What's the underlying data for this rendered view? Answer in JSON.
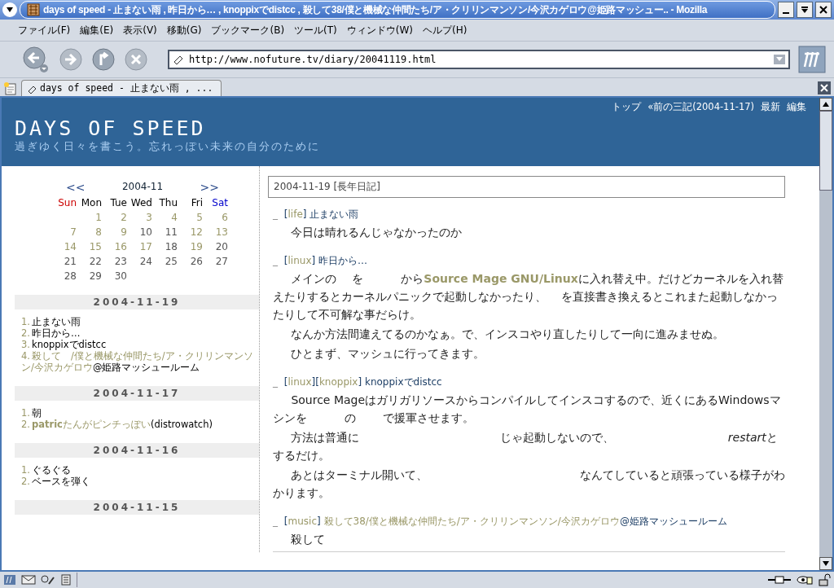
{
  "window": {
    "title": "days of speed - 止まない雨 , 昨日から… , knoppixでdistcc , 殺して38/僕と機械な仲間たち/ア・クリリンマンソン/今沢カゲロウ@姫路マッシュー.. - Mozilla"
  },
  "menu": [
    "ファイル(F)",
    "編集(E)",
    "表示(V)",
    "移動(G)",
    "ブックマーク(B)",
    "ツール(T)",
    "ウィンドウ(W)",
    "ヘルプ(H)"
  ],
  "toolbar": {
    "url": "http://www.nofuture.tv/diary/20041119.html"
  },
  "tabs": [
    {
      "label": "days of speed - 止まない雨 , ...",
      "selected": true
    }
  ],
  "header": {
    "title": "DAYS OF SPEED",
    "subtitle": "過ぎゆく日々を書こう。忘れっぽい未来の自分のために",
    "nav": [
      "トップ",
      "«前の三記(2004-11-17)",
      "最新",
      "編集"
    ]
  },
  "calendar": {
    "prev": "<<",
    "month": "2004-11",
    "next": ">>",
    "weekdays": [
      {
        "label": "Sun",
        "color": "#cc0000"
      },
      {
        "label": "Mon",
        "color": "#000000"
      },
      {
        "label": "Tue",
        "color": "#000000"
      },
      {
        "label": "Wed",
        "color": "#000000"
      },
      {
        "label": "Thu",
        "color": "#000000"
      },
      {
        "label": "Fri",
        "color": "#000000"
      },
      {
        "label": "Sat",
        "color": "#0000cc"
      }
    ],
    "days": [
      {
        "label": "1",
        "linked": true
      },
      {
        "label": "2",
        "linked": true
      },
      {
        "label": "3",
        "linked": true
      },
      {
        "label": "4",
        "linked": true
      },
      {
        "label": "5",
        "linked": true
      },
      {
        "label": "6",
        "linked": true
      },
      {
        "label": "7",
        "linked": true
      },
      {
        "label": "8",
        "linked": true
      },
      {
        "label": "9",
        "linked": true
      },
      {
        "label": "10",
        "linked": false
      },
      {
        "label": "11",
        "linked": false
      },
      {
        "label": "12",
        "linked": true
      },
      {
        "label": "13",
        "linked": true
      },
      {
        "label": "14",
        "linked": true
      },
      {
        "label": "15",
        "linked": true
      },
      {
        "label": "16",
        "linked": true
      },
      {
        "label": "17",
        "linked": true
      },
      {
        "label": "18",
        "linked": false
      },
      {
        "label": "19",
        "linked": true
      },
      {
        "label": "20",
        "linked": false
      },
      {
        "label": "21",
        "linked": false
      },
      {
        "label": "22",
        "linked": false
      },
      {
        "label": "23",
        "linked": false
      },
      {
        "label": "24",
        "linked": false
      },
      {
        "label": "25",
        "linked": false
      },
      {
        "label": "26",
        "linked": false
      },
      {
        "label": "27",
        "linked": false
      },
      {
        "label": "28",
        "linked": false
      },
      {
        "label": "29",
        "linked": false
      },
      {
        "label": "30",
        "linked": false
      }
    ]
  },
  "recent": [
    {
      "date": "2004-11-19",
      "items": [
        {
          "num": "1.",
          "parts": [
            {
              "kind": "text",
              "text": "止まない雨"
            }
          ]
        },
        {
          "num": "2.",
          "parts": [
            {
              "kind": "text",
              "text": "昨日から…"
            }
          ]
        },
        {
          "num": "3.",
          "parts": [
            {
              "kind": "text",
              "text": "knoppixでdistcc"
            }
          ]
        },
        {
          "num": "4.",
          "parts": [
            {
              "kind": "link",
              "text": "殺して　/僕と機械な仲間たち/ア・クリリンマンソン/今沢カゲロウ"
            },
            {
              "kind": "text",
              "text": "@姫路マッシュールーム"
            }
          ]
        }
      ]
    },
    {
      "date": "2004-11-17",
      "items": [
        {
          "num": "1.",
          "parts": [
            {
              "kind": "text",
              "text": "朝"
            }
          ]
        },
        {
          "num": "2.",
          "parts": [
            {
              "kind": "link",
              "text": "**patric**たんがピンチっぽい"
            },
            {
              "kind": "text",
              "text": "(distrowatch)"
            }
          ]
        }
      ]
    },
    {
      "date": "2004-11-16",
      "items": [
        {
          "num": "1.",
          "parts": [
            {
              "kind": "text",
              "text": "ぐるぐる"
            }
          ]
        },
        {
          "num": "2.",
          "parts": [
            {
              "kind": "text",
              "text": "ベースを弾く"
            }
          ]
        }
      ]
    },
    {
      "date": "2004-11-15"
    }
  ],
  "diary": {
    "date_heading": "2004-11-19 [長年日記]",
    "entries": [
      {
        "anchor": "_",
        "categories": [
          {
            "open": "[",
            "label": "life",
            "close": "]"
          }
        ],
        "title": [
          {
            "kind": "title",
            "text": "止まない雨"
          }
        ],
        "paragraphs": [
          [
            {
              "kind": "text",
              "text": "今日は晴れるんじゃなかったのか"
            }
          ]
        ]
      },
      {
        "anchor": "_",
        "categories": [
          {
            "open": "[",
            "label": "linux",
            "close": "]"
          }
        ],
        "title": [
          {
            "kind": "title",
            "text": "昨日から…"
          }
        ],
        "paragraphs": [
          [
            {
              "kind": "text",
              "text": "メインの　 を　　　 から"
            },
            {
              "kind": "link",
              "text": "Source Mage GNU/Linux"
            },
            {
              "kind": "text",
              "text": "に入れ替え中。だけどカーネルを入れ替えたりするとカーネルパニックで起動しなかったり、　 を直接書き換えるとこれまた起動しなかったりして不可解な事だらけ。"
            }
          ],
          [
            {
              "kind": "text",
              "text": "なんか方法間違えてるのかなぁ。で、インスコやり直したりして一向に進みませぬ。"
            }
          ],
          [
            {
              "kind": "text",
              "text": "ひとまず、マッシュに行ってきます。"
            }
          ]
        ]
      },
      {
        "anchor": "_",
        "categories": [
          {
            "open": "[",
            "label": "linux",
            "close": "]"
          },
          {
            "open": "[",
            "label": "knoppix",
            "close": "]"
          }
        ],
        "title": [
          {
            "kind": "title",
            "text": "knoppixでdistcc"
          }
        ],
        "paragraphs": [
          [
            {
              "kind": "text",
              "text": "Source Mageはガリガリソースからコンパイルしてインスコするので、近くにあるWindowsマシンを　　　 の　　 で援軍させます。"
            }
          ],
          [
            {
              "kind": "text",
              "text": "方法は普通に　　　　　　　　　　　　 じゃ起動しないので、　　　　　　　　　　"
            },
            {
              "kind": "italic",
              "text": "restart"
            },
            {
              "kind": "text",
              "text": "とするだけ。"
            }
          ],
          [
            {
              "kind": "text",
              "text": "あとはターミナル開いて、　　　　　　　　　　　　　 なんてしていると頑張っている様子がわかります。"
            }
          ]
        ]
      },
      {
        "anchor": "_",
        "categories": [
          {
            "open": "[",
            "label": "music",
            "close": "]"
          }
        ],
        "title": [
          {
            "kind": "link",
            "text": "殺して38/僕と機械な仲間たち/ア・クリリンマンソン/今沢カゲロウ"
          },
          {
            "kind": "title",
            "text": "@姫路マッシュールーム"
          }
        ],
        "paragraphs": [
          [
            {
              "kind": "text",
              "text": "殺して"
            }
          ]
        ]
      }
    ]
  }
}
